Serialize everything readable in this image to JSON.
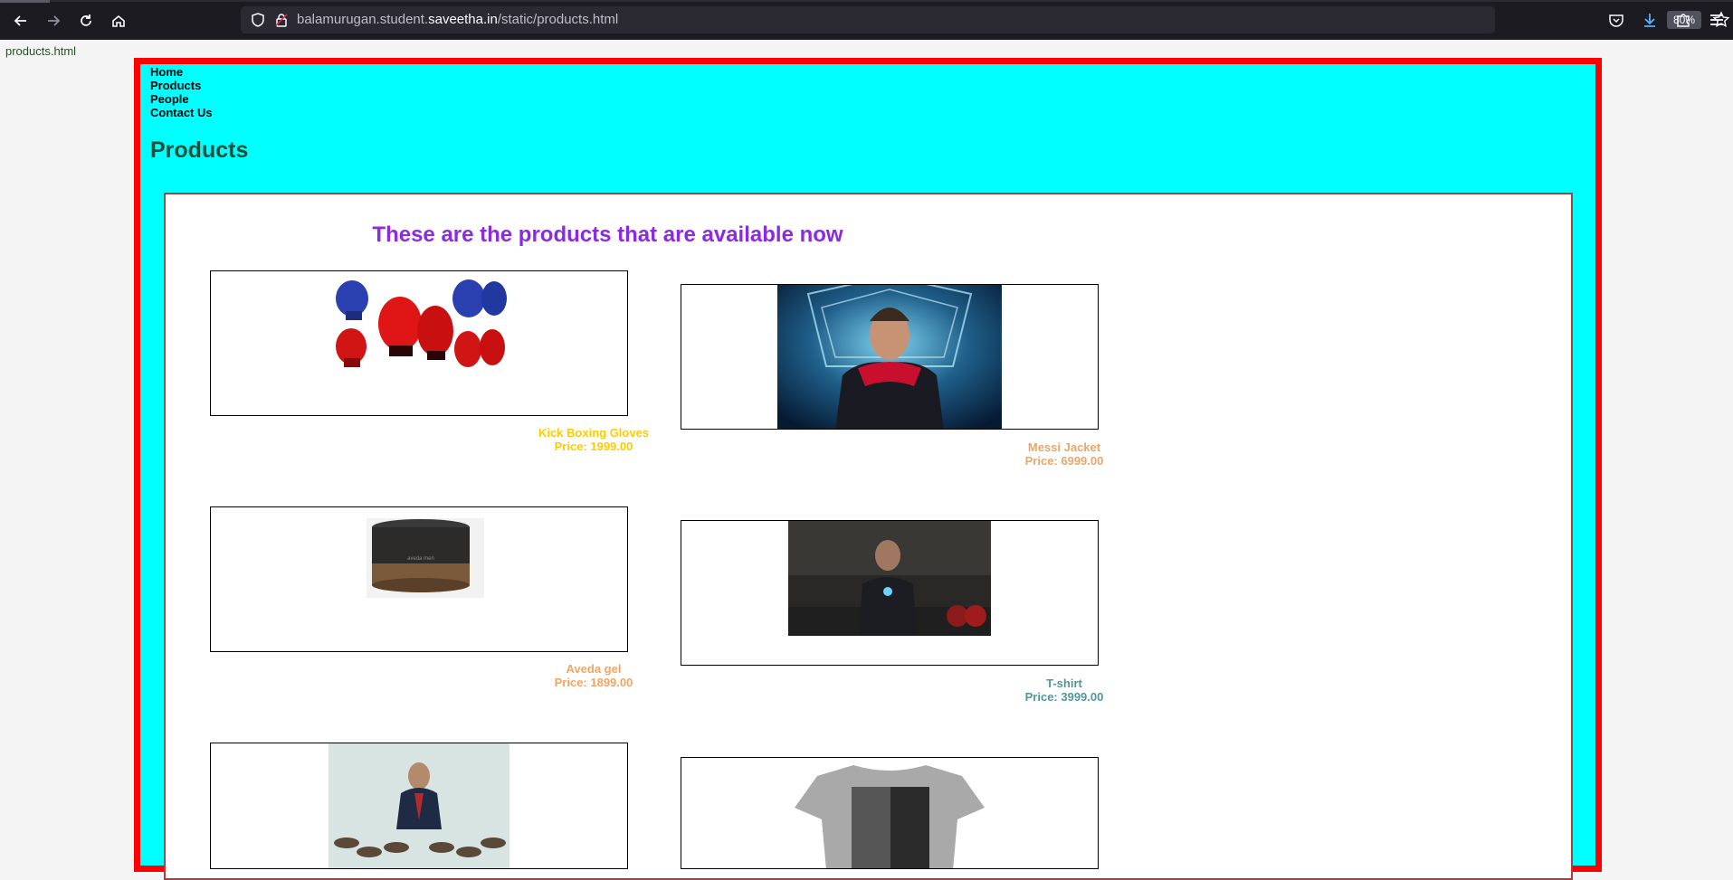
{
  "browser": {
    "url_prefix": "balamurugan.student.",
    "url_host": "saveetha.in",
    "url_path": "/static/products.html",
    "zoom": "80%"
  },
  "page": {
    "filename": "products.html",
    "nav": [
      "Home",
      "Products",
      "People",
      "Contact Us"
    ],
    "title": "Products",
    "heading": "These are the products that are available now"
  },
  "products": [
    {
      "name": "Kick Boxing Gloves",
      "price": "Price: 1999.00",
      "color": "#ffcc00"
    },
    {
      "name": "Messi Jacket",
      "price": "Price: 6999.00",
      "color": "#e9a66a"
    },
    {
      "name": "Aveda gel",
      "price": "Price: 1899.00",
      "color": "#f4a460"
    },
    {
      "name": "T-shirt",
      "price": "Price: 3999.00",
      "color": "#4f979c"
    }
  ],
  "colors": {
    "frame_border": "#ff0000",
    "frame_bg": "#00ffff",
    "heading": "#8a2be2"
  }
}
